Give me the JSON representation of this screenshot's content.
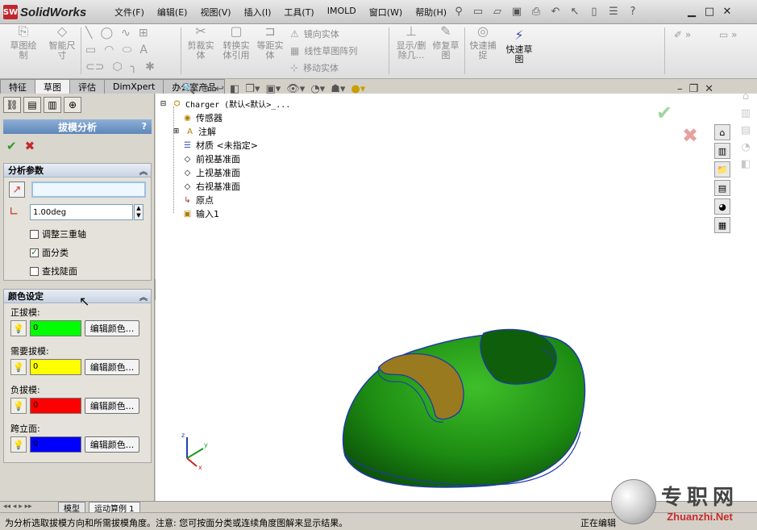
{
  "app": {
    "name": "SolidWorks",
    "logo_letters": "SW"
  },
  "menu": [
    "文件(F)",
    "编辑(E)",
    "视图(V)",
    "插入(I)",
    "工具(T)",
    "IMOLD",
    "窗口(W)",
    "帮助(H)"
  ],
  "toolbar": {
    "sketch_drawing": "草图绘制",
    "smart_dimension": "智能尺寸",
    "trim_entities": "剪裁实体",
    "convert_entities": "转换实体引用",
    "offset_entities": "等距实体",
    "mirror_entities": "镜向实体",
    "linear_pattern": "线性草图阵列",
    "move_entities": "移动实体",
    "show_delete_relations": "显示/删除几...",
    "repair_sketch": "修复草图",
    "quick_snaps": "快速捕捉",
    "rapid_sketch": "快速草图"
  },
  "tabs": [
    "特征",
    "草图",
    "评估",
    "DimXpert",
    "办公室产品"
  ],
  "active_tab": "草图",
  "panel": {
    "title": "拔模分析",
    "help": "?",
    "analysis_params": {
      "header": "分析参数",
      "angle_value": "1.00deg",
      "options": [
        {
          "label": "调整三重轴",
          "checked": false
        },
        {
          "label": "面分类",
          "checked": true
        },
        {
          "label": "查找陡面",
          "checked": false
        }
      ]
    },
    "color_settings": {
      "header": "颜色设定",
      "edit_label": "编辑颜色...",
      "rows": [
        {
          "label": "正拔模:",
          "count": "0",
          "color": "#00ff00"
        },
        {
          "label": "需要拔模:",
          "count": "0",
          "color": "#ffff00"
        },
        {
          "label": "负拔模:",
          "count": "0",
          "color": "#ff0000"
        },
        {
          "label": "跨立面:",
          "count": "0",
          "color": "#0000ff"
        }
      ]
    }
  },
  "tree": {
    "root": "Charger  (默认<默认>_...",
    "items": [
      "传感器",
      "注解",
      "材质 <未指定>",
      "前视基准面",
      "上视基准面",
      "右视基准面",
      "原点",
      "输入1"
    ]
  },
  "colors": {
    "model_green": "#1c8c12",
    "model_edge": "#1e3aa8",
    "insert_brown": "#9a7a1e",
    "confirm_green": "#2c9a2c",
    "cancel_red": "#c42828"
  },
  "bottom_tabs": [
    "模型",
    "运动算例 1"
  ],
  "status": {
    "message": "为分析选取拔模方向和所需拔模角度。注意: 您可按面分类或连续角度图解来显示结果。",
    "mode": "正在编辑"
  },
  "triad": {
    "x": "x",
    "y": "y",
    "z": "z"
  },
  "watermark": {
    "title": "专职网",
    "url": "Zhuanzhi.Net"
  }
}
